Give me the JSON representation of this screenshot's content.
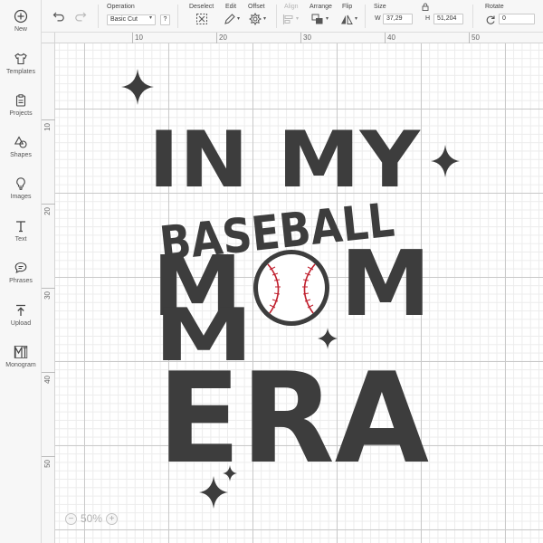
{
  "sidebar": {
    "items": [
      {
        "label": "New",
        "icon": "plus-circle-icon"
      },
      {
        "label": "Templates",
        "icon": "shirt-icon"
      },
      {
        "label": "Projects",
        "icon": "clipboard-icon"
      },
      {
        "label": "Shapes",
        "icon": "shapes-icon"
      },
      {
        "label": "Images",
        "icon": "lightbulb-icon"
      },
      {
        "label": "Text",
        "icon": "text-icon"
      },
      {
        "label": "Phrases",
        "icon": "speech-bubble-icon"
      },
      {
        "label": "Upload",
        "icon": "upload-icon"
      },
      {
        "label": "Monogram",
        "icon": "monogram-icon"
      }
    ]
  },
  "toolbar": {
    "operation_label": "Operation",
    "operation_value": "Basic Cut",
    "operation_help": "?",
    "deselect_label": "Deselect",
    "edit_label": "Edit",
    "offset_label": "Offset",
    "align_label": "Align",
    "arrange_label": "Arrange",
    "flip_label": "Flip",
    "size_label": "Size",
    "width_prefix": "W",
    "width_value": "37,29",
    "height_prefix": "H",
    "height_value": "51,204",
    "rotate_label": "Rotate",
    "rotate_value": "0"
  },
  "rulers": {
    "top": [
      "10",
      "20",
      "30",
      "40",
      "50"
    ],
    "left": [
      "10",
      "20",
      "30",
      "40",
      "50"
    ]
  },
  "design": {
    "line1": "IN MY",
    "line2": "BASEBALL",
    "line3_left": "M",
    "line3_right": "M",
    "line4_left": "M",
    "line5": "ERA"
  },
  "zoom": {
    "minus": "−",
    "value": "50%",
    "plus": "+"
  },
  "colors": {
    "design_fill": "#3d3d3d",
    "stitch": "#c0212f"
  }
}
